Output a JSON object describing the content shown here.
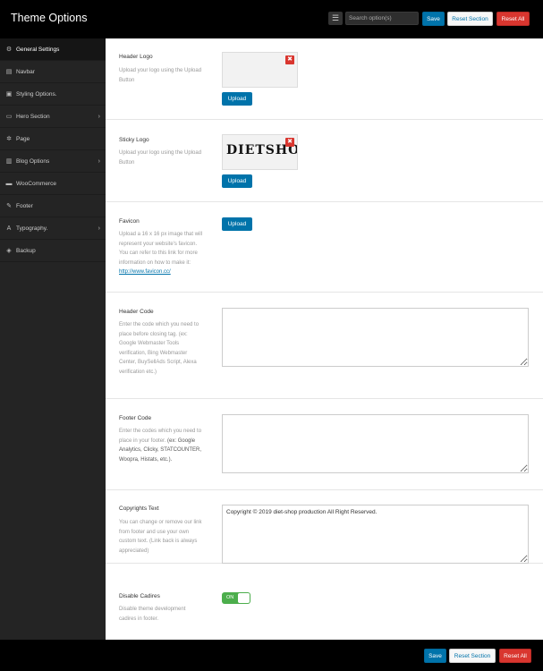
{
  "header": {
    "title": "Theme Options",
    "search_placeholder": "Search option(s)",
    "save_label": "Save",
    "reset_section_label": "Reset Section",
    "reset_all_label": "Reset All"
  },
  "sidebar": {
    "items": [
      {
        "label": "General Settings",
        "icon": "gear-icon",
        "active": true
      },
      {
        "label": "Navbar",
        "icon": "navbar-icon"
      },
      {
        "label": "Styling Options.",
        "icon": "styling-icon"
      },
      {
        "label": "Hero Section",
        "icon": "hero-icon",
        "has_children": true
      },
      {
        "label": "Page",
        "icon": "cogs-icon"
      },
      {
        "label": "Blog Options",
        "icon": "blog-icon",
        "has_children": true
      },
      {
        "label": "WooCommerce",
        "icon": "cart-icon"
      },
      {
        "label": "Footer",
        "icon": "edit-icon"
      },
      {
        "label": "Typography.",
        "icon": "font-icon",
        "has_children": true
      },
      {
        "label": "Backup",
        "icon": "shield-icon"
      }
    ]
  },
  "options": {
    "header_logo": {
      "title": "Header Logo",
      "desc": "Upload your logo using the Upload Button",
      "upload_label": "Upload"
    },
    "sticky_logo": {
      "title": "Sticky Logo",
      "desc": "Upload your logo using the Upload Button",
      "upload_label": "Upload",
      "logo_text": "DIETSHO"
    },
    "favicon": {
      "title": "Favicon",
      "desc": "Upload a 16 x 16 px image that will represent your website's favicon. You can refer to this link for more information on how to make it: ",
      "link": "http://www.favicon.cc/",
      "upload_label": "Upload"
    },
    "header_code": {
      "title": "Header Code",
      "desc": "Enter the code which you need to place before closing tag. (ex: Google Webmaster Tools verification, Bing Webmaster Center, BuySellAds Script, Alexa verification etc.)",
      "value": ""
    },
    "footer_code": {
      "title": "Footer Code",
      "desc_plain": "Enter the codes which you need to place in your footer.",
      "desc_bold": "(ex: Google Analytics, Clicky, STATCOUNTER, Woopra, Histats, etc.).",
      "value": ""
    },
    "copyrights": {
      "title": "Copyrights Text",
      "desc": "You can change or remove our link from footer and use your own custom text. (Link back is always appreciated)",
      "value": "Copyright © 2019 diet-shop production All Right Reserved."
    },
    "disable_credits": {
      "title": "Disable Cadires",
      "desc": "Disable theme development cadires in footer.",
      "toggle_label": "ON",
      "enabled": true
    }
  },
  "footer": {
    "save_label": "Save",
    "reset_section_label": "Reset Section",
    "reset_all_label": "Reset All"
  },
  "colors": {
    "accent": "#0073aa",
    "danger": "#d9362f",
    "toggle_on": "#4cae4c"
  }
}
